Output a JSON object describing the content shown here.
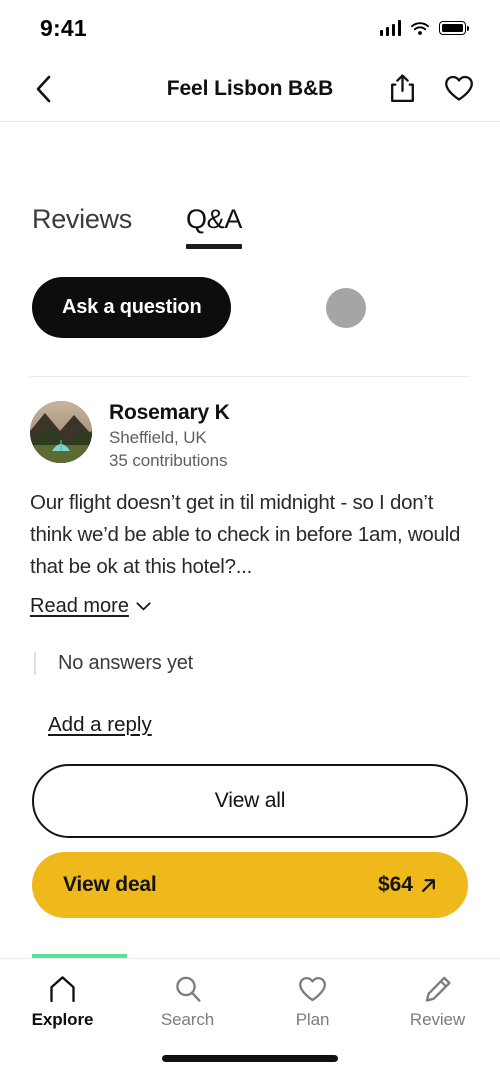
{
  "status_bar": {
    "time": "9:41",
    "signal_icon": "cellular-signal-icon",
    "wifi_icon": "wifi-icon",
    "battery_icon": "battery-full-icon"
  },
  "app_bar": {
    "back_icon": "chevron-left-icon",
    "title": "Feel Lisbon B&B",
    "share_icon": "share-icon",
    "favorite_icon": "heart-outline-icon"
  },
  "tabs": [
    {
      "label": "Reviews",
      "active": false
    },
    {
      "label": "Q&A",
      "active": true
    }
  ],
  "ask_section": {
    "button_label": "Ask a question",
    "avatar_placeholder": "avatar-placeholder-circle"
  },
  "question": {
    "author": "Rosemary K",
    "location": "Sheffield, UK",
    "contributions": "35 contributions",
    "avatar_alt": "camping-tent-photo",
    "body": "Our flight doesn’t get in til midnight - so I don’t think we’d be able to check in before 1am, would that be ok at this hotel?...",
    "read_more_label": "Read more",
    "read_more_icon": "chevron-down-icon",
    "answers_status": "No answers yet",
    "add_reply_label": "Add a reply"
  },
  "cta": {
    "view_all_label": "View all",
    "view_deal_label": "View deal",
    "price": "$64",
    "price_icon": "arrow-up-right-icon"
  },
  "bottom_nav": [
    {
      "label": "Explore",
      "icon": "home-icon",
      "active": true
    },
    {
      "label": "Search",
      "icon": "search-icon",
      "active": false
    },
    {
      "label": "Plan",
      "icon": "heart-icon",
      "active": false
    },
    {
      "label": "Review",
      "icon": "pencil-icon",
      "active": false
    }
  ],
  "colors": {
    "deal_yellow": "#EFB81B",
    "accent_green": "#54e39b",
    "primary_black": "#0d0d0d"
  }
}
